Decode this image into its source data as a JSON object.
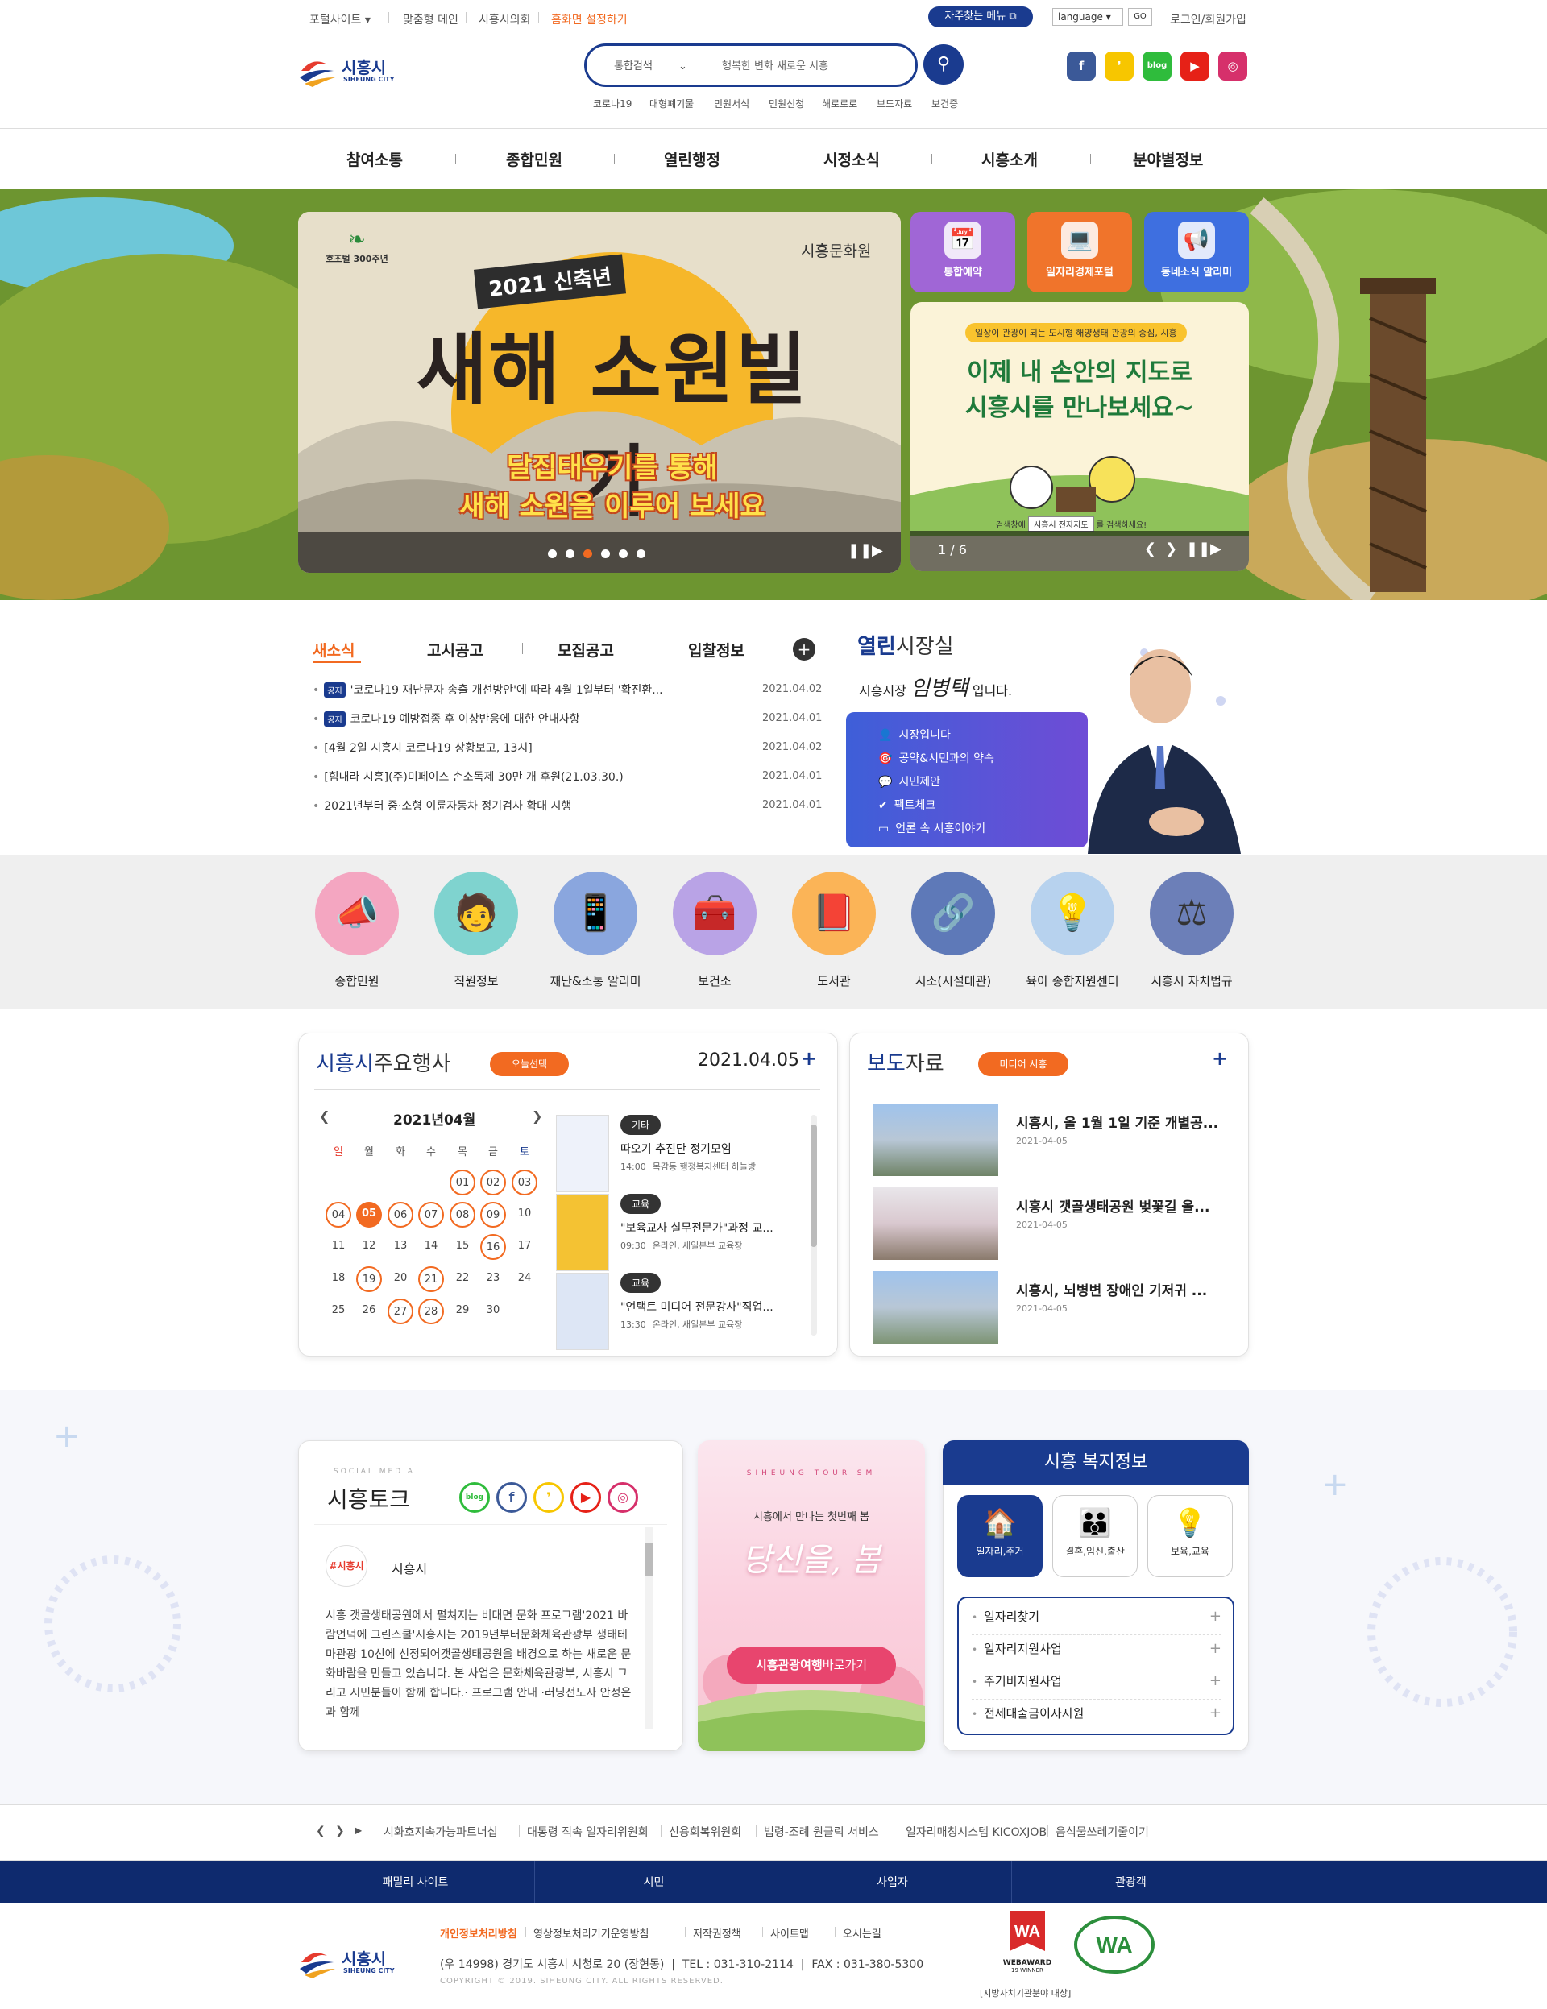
{
  "util": {
    "portal": "포털사이트",
    "custom_main": "맞춤형 메인",
    "council": "시흥시의회",
    "set_home": "홈화면 설정하기",
    "faq": "자주찾는 메뉴",
    "lang": "language",
    "go": "GO",
    "login": "로그인/회원가입"
  },
  "header": {
    "logo_ko": "시흥시",
    "logo_en": "SIHEUNG CITY",
    "search_scope": "통합검색",
    "search_placeholder": "행복한 변화 새로운 시흥",
    "keywords": [
      "코로나19",
      "대형폐기물",
      "민원서식",
      "민원신청",
      "해로로로",
      "보도자료",
      "보건증"
    ],
    "sns": [
      {
        "name": "facebook",
        "label": "f",
        "color": "#3b5998"
      },
      {
        "name": "kakao",
        "label": "❜",
        "color": "#f7c600"
      },
      {
        "name": "blog",
        "label": "blog",
        "color": "#2fbc3c"
      },
      {
        "name": "youtube",
        "label": "▶",
        "color": "#e62117"
      },
      {
        "name": "instagram",
        "label": "◎",
        "color": "#d6306b"
      }
    ]
  },
  "gnb": [
    "참여소통",
    "종합민원",
    "열린행정",
    "시정소식",
    "시흥소개",
    "분야별정보"
  ],
  "hero": {
    "banner1": {
      "badge_top": "호조벌 300주년",
      "org": "시흥문화원",
      "year": "2021 신축년",
      "title": "새해 소원빌기",
      "line1": "달집태우기를 통해",
      "line2": "새해 소원을 이루어 보세요"
    },
    "quick": [
      {
        "label": "통합예약",
        "color": "#a066d6",
        "icon": "📅"
      },
      {
        "label": "일자리경제포털",
        "color": "#f0742b",
        "icon": "💻"
      },
      {
        "label": "동네소식 알리미",
        "color": "#3e6fe0",
        "icon": "📢"
      }
    ],
    "banner2": {
      "top": "일상이 관광이 되는 도시형 해양생태 관광의 중심, 시흥",
      "line1": "이제 내 손안의 지도로",
      "line2": "시흥시를 만나보세요~",
      "search_text": "검색창에",
      "search_box": "시흥시 전자지도",
      "search_after": "를 검색하세요!"
    },
    "page": "1 / 6"
  },
  "news": {
    "tabs": [
      "새소식",
      "고시공고",
      "모집공고",
      "입찰정보"
    ],
    "tag": "공지",
    "items": [
      {
        "notice": true,
        "title": "'코로나19 재난문자 송출 개선방안'에 따라 4월 1일부터 '확진환...",
        "date": "2021.04.02"
      },
      {
        "notice": true,
        "title": "코로나19 예방접종 후 이상반응에 대한 안내사항",
        "date": "2021.04.01"
      },
      {
        "notice": false,
        "title": "[4월 2일 시흥시 코로나19 상황보고, 13시]",
        "date": "2021.04.02"
      },
      {
        "notice": false,
        "title": "[힘내라 시흥](주)미페이스 손소독제 30만 개 후원(21.03.30.)",
        "date": "2021.04.01"
      },
      {
        "notice": false,
        "title": "2021년부터 중·소형 이륜자동차 정기검사 확대 시행",
        "date": "2021.04.01"
      }
    ]
  },
  "mayor": {
    "title_bold": "열린",
    "title": "시장실",
    "intro": "시흥시장",
    "name": "임병택",
    "intro_end": "입니다.",
    "links": [
      "시장입니다",
      "공약&시민과의 약속",
      "시민제안",
      "팩트체크",
      "언론 속 시흥이야기"
    ]
  },
  "quick_icons": [
    {
      "label": "종합민원",
      "bg": "#f4a6c1",
      "icon": "📣"
    },
    {
      "label": "직원정보",
      "bg": "#7fd3cf",
      "icon": "🧑"
    },
    {
      "label": "재난&소통 알리미",
      "bg": "#8aa6de",
      "icon": "📱"
    },
    {
      "label": "보건소",
      "bg": "#b9a3e6",
      "icon": "🧰"
    },
    {
      "label": "도서관",
      "bg": "#fbb457",
      "icon": "📕"
    },
    {
      "label": "시소(시설대관)",
      "bg": "#5e79b8",
      "icon": "🔗"
    },
    {
      "label": "육아 종합지원센터",
      "bg": "#b7d2ee",
      "icon": "💡"
    },
    {
      "label": "시흥시 자치법규",
      "bg": "#6c7fb8",
      "icon": "⚖"
    }
  ],
  "events": {
    "title_hl": "시흥시",
    "title": "주요행사",
    "btn": "오늘선택",
    "date": "2021.04.05",
    "month_label": "2021년04월",
    "days": [
      "일",
      "월",
      "화",
      "수",
      "목",
      "금",
      "토"
    ],
    "weeks": [
      [
        "",
        "",
        "",
        "",
        "01",
        "02",
        "03"
      ],
      [
        "04",
        "05",
        "06",
        "07",
        "08",
        "09",
        "10"
      ],
      [
        "11",
        "12",
        "13",
        "14",
        "15",
        "16",
        "17"
      ],
      [
        "18",
        "19",
        "20",
        "21",
        "22",
        "23",
        "24"
      ],
      [
        "25",
        "26",
        "27",
        "28",
        "29",
        "30",
        ""
      ]
    ],
    "list": [
      {
        "tag": "기타",
        "title": "따오기 추진단 정기모임",
        "time": "14:00",
        "place": "목감동 행정복지센터 하늘방"
      },
      {
        "tag": "교육",
        "title": "\"보육교사 실무전문가\"과정 교...",
        "time": "09:30",
        "place": "온라인, 새일본부 교육장"
      },
      {
        "tag": "교육",
        "title": "\"언택트 미디어 전문강사\"직업...",
        "time": "13:30",
        "place": "온라인, 새일본부 교육장"
      }
    ]
  },
  "press": {
    "title_hl": "보도",
    "title": "자료",
    "btn": "미디어 시흥",
    "items": [
      {
        "title": "시흥시, 올 1월 1일 기준 개별공...",
        "date": "2021-04-05"
      },
      {
        "title": "시흥시 갯골생태공원 벚꽃길 올...",
        "date": "2021-04-05"
      },
      {
        "title": "시흥시, 뇌병변 장애인 기저귀 ...",
        "date": "2021-04-05"
      }
    ]
  },
  "talk": {
    "sub": "SOCIAL MEDIA",
    "title": "시흥토크",
    "handle_badge": "#시흥시",
    "handle": "시흥시",
    "body": "시흥 갯골생태공원에서 펼쳐지는 비대면 문화 프로그램'2021 바람언덕에 그린스쿨'시흥시는 2019년부터문화체육관광부 생태테마관광 10선에 선정되어갯골생태공원을 배경으로 하는 새로운 문화바람을 만들고 있습니다. 본 사업은 문화체육관광부, 시흥시 그리고 시민분들이 함께 합니다.· 프로그램 안내 ·러닝전도사 안정은과 함께"
  },
  "tourism": {
    "en": "SIHEUNG TOURISM",
    "sub": "시흥에서 만나는 첫번째 봄",
    "title": "당신을, 봄",
    "btn_hl": "시흥관광여행",
    "btn": "바로가기"
  },
  "welfare": {
    "title_hl": "시흥",
    "title": "복지정보",
    "cats": [
      "일자리,주거",
      "결혼,임신,출산",
      "보육,교육"
    ],
    "items": [
      "일자리찾기",
      "일자리지원사업",
      "주거비지원사업",
      "전세대출금이자지원"
    ]
  },
  "footer": {
    "links": [
      "시화호지속가능파트너십",
      "대통령 직속 일자리위원회",
      "신용회복위원회",
      "법령-조례 원클릭 서비스",
      "일자리매칭시스템 KICOXJOB",
      "음식물쓰레기줄이기"
    ],
    "family": [
      "패밀리 사이트",
      "시민",
      "사업자",
      "관광객"
    ],
    "policy": [
      "개인정보처리방침",
      "영상정보처리기기운영방침",
      "저작권정책",
      "사이트맵",
      "오시는길"
    ],
    "address": "(우 14998) 경기도 시흥시 시청로 20 (장현동)",
    "tel": "TEL : 031-310-2114",
    "fax": "FAX : 031-380-5300",
    "copyright": "COPYRIGHT © 2019. SIHEUNG CITY. ALL RIGHTS RESERVED.",
    "award": "WEBAWARD",
    "award2": "19 WINNER",
    "wa_caption": "[지방자치기관분야 대상]"
  }
}
